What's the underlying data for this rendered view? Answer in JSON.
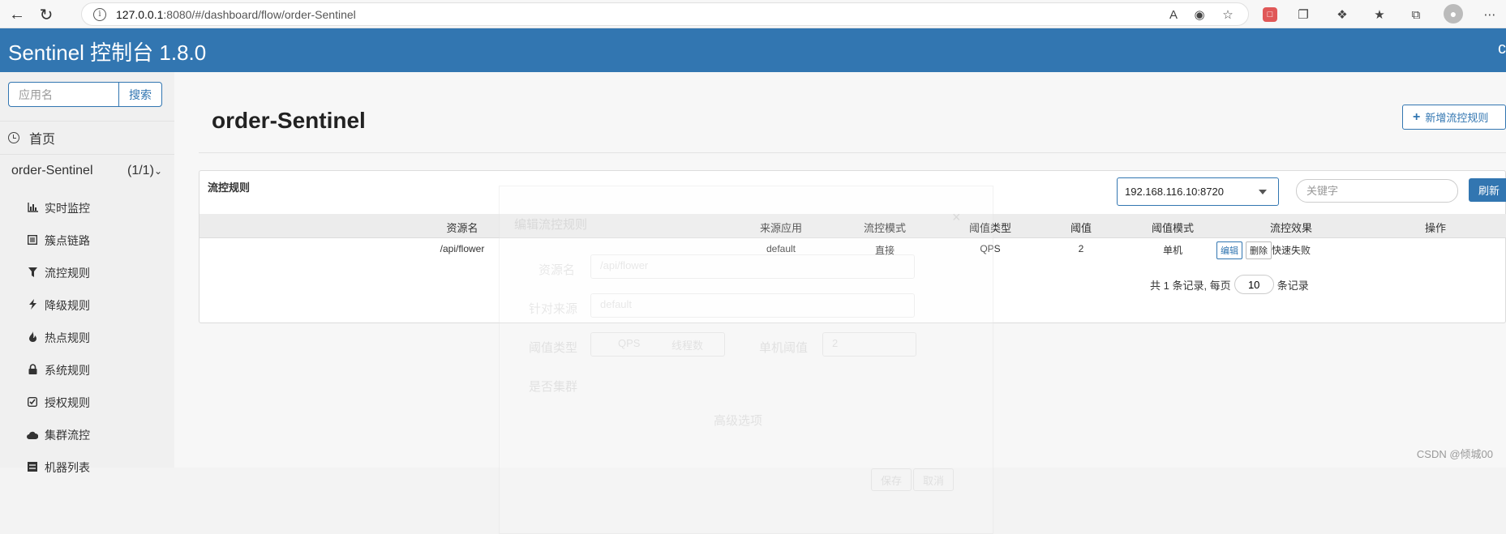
{
  "browser": {
    "url_host": "127.0.0.1",
    "url_rest": ":8080/#/dashboard/flow/order-Sentinel"
  },
  "app": {
    "title": "Sentinel 控制台 1.8.0",
    "header_edge_text": "c"
  },
  "sidebar": {
    "search_placeholder": "应用名",
    "search_button": "搜索",
    "home_label": "首页",
    "app_name": "order-Sentinel",
    "app_count": "(1/1)",
    "menu_items": [
      {
        "label": "实时监控",
        "icon": "bar-chart-icon"
      },
      {
        "label": "簇点链路",
        "icon": "list-icon"
      },
      {
        "label": "流控规则",
        "icon": "filter-icon"
      },
      {
        "label": "降级规则",
        "icon": "flash-icon"
      },
      {
        "label": "热点规则",
        "icon": "fire-icon"
      },
      {
        "label": "系统规则",
        "icon": "lock-icon"
      },
      {
        "label": "授权规则",
        "icon": "check-square-icon"
      },
      {
        "label": "集群流控",
        "icon": "cloud-icon"
      },
      {
        "label": "机器列表",
        "icon": "server-icon"
      }
    ]
  },
  "main": {
    "page_title": "order-Sentinel",
    "add_rule_button": "新增流控规则",
    "panel_title": "流控规则",
    "machine_select": "192.168.116.10:8720",
    "keyword_placeholder": "关键字",
    "refresh_button": "刷新",
    "columns": [
      "资源名",
      "来源应用",
      "流控模式",
      "阈值类型",
      "阈值",
      "阈值模式",
      "流控效果",
      "操作"
    ],
    "rows": [
      {
        "resource": "/api/flower",
        "limit_app": "default",
        "mode": "直接",
        "grade": "QPS",
        "count": "2",
        "cluster_mode": "单机",
        "effect": "快速失败",
        "edit_label": "编辑",
        "delete_label": "删除"
      }
    ],
    "pager": {
      "prefix": "共 1 条记录, 每页",
      "page_size": "10",
      "suffix": "条记录"
    }
  },
  "ghost_modal": {
    "title": "编辑流控规则",
    "resource_label": "资源名",
    "resource_value": "/api/flower",
    "limit_app_label": "针对来源",
    "limit_app_value": "default",
    "grade_label": "阈值类型",
    "grade_qps": "QPS",
    "grade_threads": "线程数",
    "count_label": "单机阈值",
    "count_value": "2",
    "cluster_label": "是否集群",
    "advanced": "高级选项",
    "save": "保存",
    "cancel": "取消",
    "close": "×"
  },
  "watermark": "CSDN @倾城00"
}
